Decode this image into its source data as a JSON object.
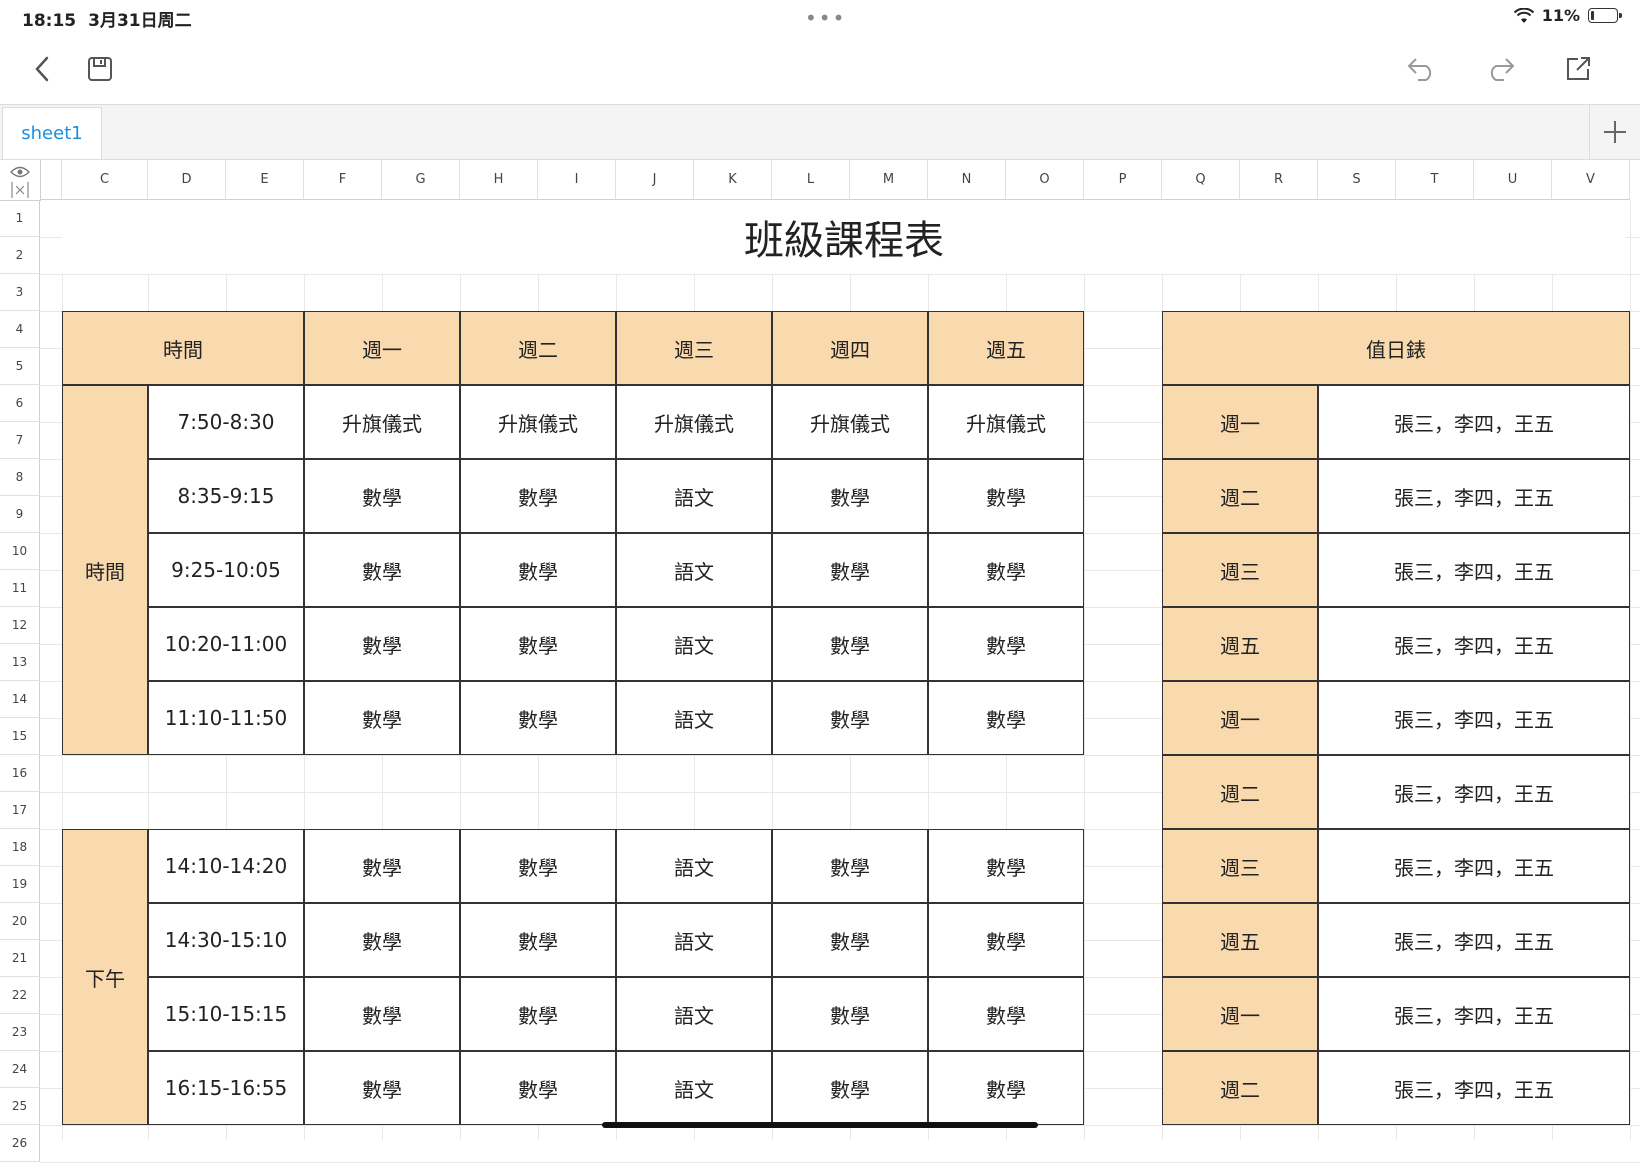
{
  "status": {
    "time": "18:15",
    "date": "3月31日周二",
    "battery": "11%"
  },
  "tabs": [
    {
      "label": "sheet1"
    }
  ],
  "columns": [
    "C",
    "D",
    "E",
    "F",
    "G",
    "H",
    "I",
    "J",
    "K",
    "L",
    "M",
    "N",
    "O",
    "P",
    "Q",
    "R",
    "S",
    "T",
    "U",
    "V"
  ],
  "rows": [
    "1",
    "2",
    "3",
    "4",
    "5",
    "6",
    "7",
    "8",
    "9",
    "10",
    "11",
    "12",
    "13",
    "14",
    "15",
    "16",
    "17",
    "18",
    "19",
    "20",
    "21",
    "22",
    "23",
    "24",
    "25",
    "26"
  ],
  "sheet": {
    "title": "班級課程表",
    "schedule_header": {
      "time": "時間",
      "days": [
        "週一",
        "週二",
        "週三",
        "週四",
        "週五"
      ]
    },
    "morning_label": "時間",
    "afternoon_label": "下午",
    "morning": [
      {
        "time": "7:50-8:30",
        "classes": [
          "升旗儀式",
          "升旗儀式",
          "升旗儀式",
          "升旗儀式",
          "升旗儀式"
        ]
      },
      {
        "time": "8:35-9:15",
        "classes": [
          "數學",
          "數學",
          "語文",
          "數學",
          "數學"
        ]
      },
      {
        "time": "9:25-10:05",
        "classes": [
          "數學",
          "數學",
          "語文",
          "數學",
          "數學"
        ]
      },
      {
        "time": "10:20-11:00",
        "classes": [
          "數學",
          "數學",
          "語文",
          "數學",
          "數學"
        ]
      },
      {
        "time": "11:10-11:50",
        "classes": [
          "數學",
          "數學",
          "語文",
          "數學",
          "數學"
        ]
      }
    ],
    "afternoon": [
      {
        "time": "14:10-14:20",
        "classes": [
          "數學",
          "數學",
          "語文",
          "數學",
          "數學"
        ]
      },
      {
        "time": "14:30-15:10",
        "classes": [
          "數學",
          "數學",
          "語文",
          "數學",
          "數學"
        ]
      },
      {
        "time": "15:10-15:15",
        "classes": [
          "數學",
          "數學",
          "語文",
          "數學",
          "數學"
        ]
      },
      {
        "time": "16:15-16:55",
        "classes": [
          "數學",
          "數學",
          "語文",
          "數學",
          "數學"
        ]
      }
    ],
    "duty": {
      "header": "值日錶",
      "rows": [
        {
          "day": "週一",
          "names": "張三，李四，王五"
        },
        {
          "day": "週二",
          "names": "張三，李四，王五"
        },
        {
          "day": "週三",
          "names": "張三，李四，王五"
        },
        {
          "day": "週五",
          "names": "張三，李四，王五"
        },
        {
          "day": "週一",
          "names": "張三，李四，王五"
        },
        {
          "day": "週二",
          "names": "張三，李四，王五"
        },
        {
          "day": "週三",
          "names": "張三，李四，王五"
        },
        {
          "day": "週五",
          "names": "張三，李四，王五"
        },
        {
          "day": "週一",
          "names": "張三，李四，王五"
        },
        {
          "day": "週二",
          "names": "張三，李四，王五"
        }
      ]
    }
  }
}
